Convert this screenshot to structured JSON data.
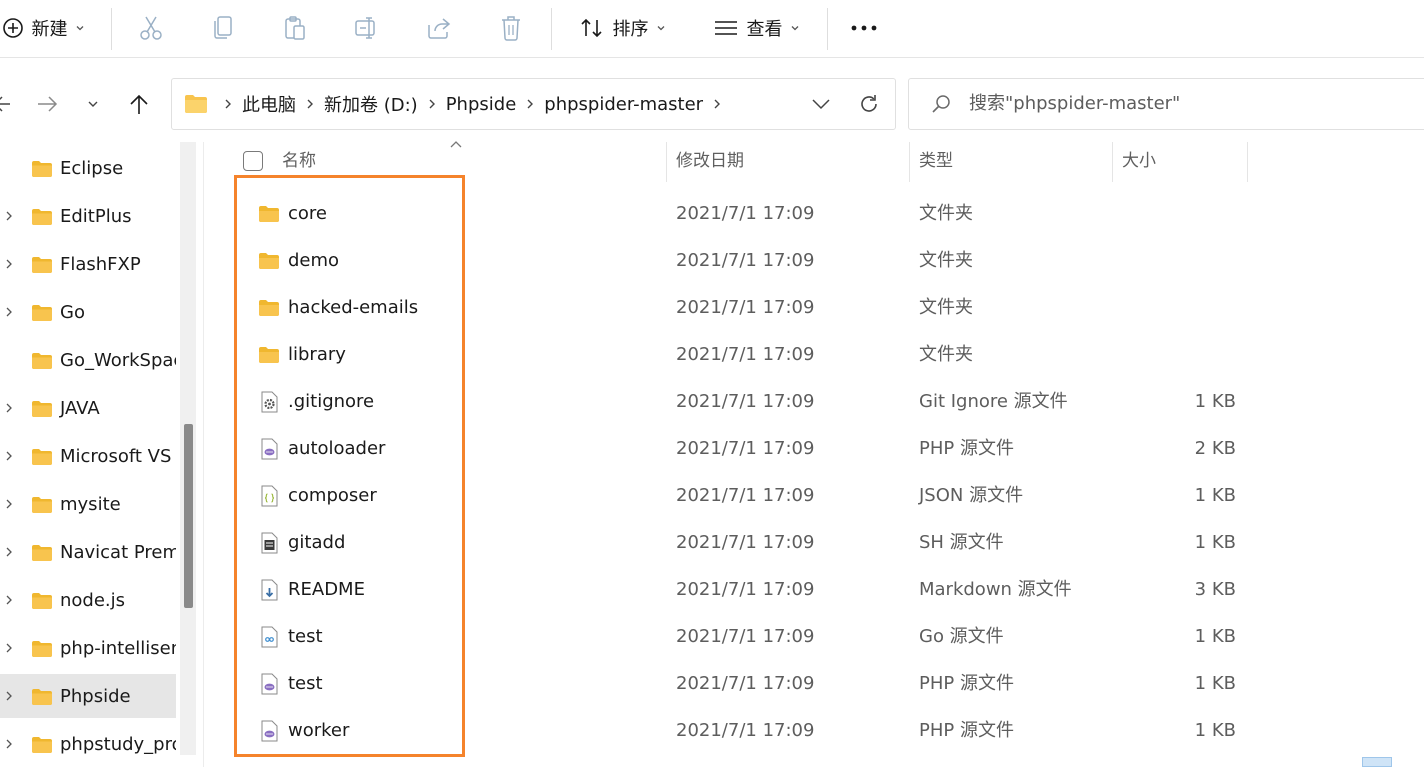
{
  "toolbar": {
    "new_label": "新建",
    "sort_label": "排序",
    "view_label": "查看"
  },
  "address": {
    "crumbs": [
      "此电脑",
      "新加卷 (D:)",
      "Phpside",
      "phpspider-master"
    ]
  },
  "search": {
    "placeholder": "搜索\"phpspider-master\""
  },
  "sidebar": {
    "items": [
      {
        "label": "Eclipse",
        "expandable": false,
        "selected": false
      },
      {
        "label": "EditPlus",
        "expandable": true,
        "selected": false
      },
      {
        "label": "FlashFXP",
        "expandable": true,
        "selected": false
      },
      {
        "label": "Go",
        "expandable": true,
        "selected": false
      },
      {
        "label": "Go_WorkSpac",
        "expandable": false,
        "selected": false
      },
      {
        "label": "JAVA",
        "expandable": true,
        "selected": false
      },
      {
        "label": "Microsoft VS C",
        "expandable": true,
        "selected": false
      },
      {
        "label": "mysite",
        "expandable": true,
        "selected": false
      },
      {
        "label": "Navicat Prem",
        "expandable": true,
        "selected": false
      },
      {
        "label": "node.js",
        "expandable": true,
        "selected": false
      },
      {
        "label": "php-intellisen",
        "expandable": true,
        "selected": false
      },
      {
        "label": "Phpside",
        "expandable": true,
        "selected": true
      },
      {
        "label": "phpstudy_pro",
        "expandable": true,
        "selected": false
      }
    ]
  },
  "columns": {
    "name": "名称",
    "modified": "修改日期",
    "type": "类型",
    "size": "大小"
  },
  "files": [
    {
      "name": "core",
      "modified": "2021/7/1 17:09",
      "type": "文件夹",
      "size": "",
      "icon": "folder-icon"
    },
    {
      "name": "demo",
      "modified": "2021/7/1 17:09",
      "type": "文件夹",
      "size": "",
      "icon": "folder-icon"
    },
    {
      "name": "hacked-emails",
      "modified": "2021/7/1 17:09",
      "type": "文件夹",
      "size": "",
      "icon": "folder-icon"
    },
    {
      "name": "library",
      "modified": "2021/7/1 17:09",
      "type": "文件夹",
      "size": "",
      "icon": "folder-icon"
    },
    {
      "name": ".gitignore",
      "modified": "2021/7/1 17:09",
      "type": "Git Ignore 源文件",
      "size": "1 KB",
      "icon": "gear-file-icon"
    },
    {
      "name": "autoloader",
      "modified": "2021/7/1 17:09",
      "type": "PHP 源文件",
      "size": "2 KB",
      "icon": "php-file-icon"
    },
    {
      "name": "composer",
      "modified": "2021/7/1 17:09",
      "type": "JSON 源文件",
      "size": "1 KB",
      "icon": "json-file-icon"
    },
    {
      "name": "gitadd",
      "modified": "2021/7/1 17:09",
      "type": "SH 源文件",
      "size": "1 KB",
      "icon": "shell-file-icon"
    },
    {
      "name": "README",
      "modified": "2021/7/1 17:09",
      "type": "Markdown 源文件",
      "size": "3 KB",
      "icon": "markdown-file-icon"
    },
    {
      "name": "test",
      "modified": "2021/7/1 17:09",
      "type": "Go 源文件",
      "size": "1 KB",
      "icon": "go-file-icon"
    },
    {
      "name": "test",
      "modified": "2021/7/1 17:09",
      "type": "PHP 源文件",
      "size": "1 KB",
      "icon": "php-file-icon"
    },
    {
      "name": "worker",
      "modified": "2021/7/1 17:09",
      "type": "PHP 源文件",
      "size": "1 KB",
      "icon": "php-file-icon"
    }
  ],
  "colors": {
    "highlight": "#f5832b",
    "folder": "#f8c44e",
    "selected_bg": "#e6e6e6"
  }
}
